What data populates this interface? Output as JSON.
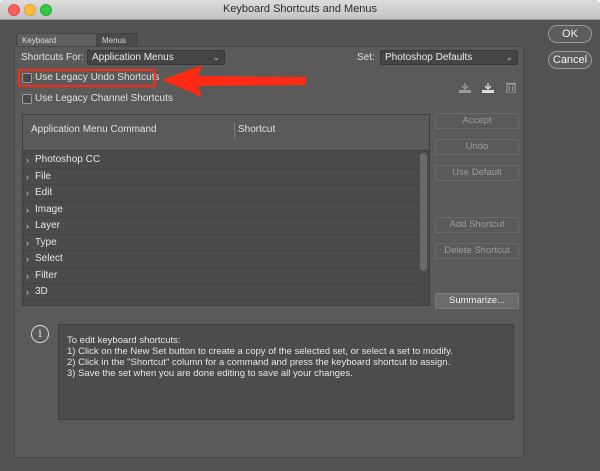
{
  "window": {
    "title": "Keyboard Shortcuts and Menus"
  },
  "tabs": [
    {
      "label": "Keyboard Shortcuts"
    },
    {
      "label": "Menus"
    }
  ],
  "shortcuts_for": {
    "label": "Shortcuts For:",
    "value": "Application Menus"
  },
  "set": {
    "label": "Set:",
    "value": "Photoshop Defaults"
  },
  "options": {
    "legacy_undo": "Use Legacy Undo Shortcuts",
    "legacy_channel": "Use Legacy Channel Shortcuts"
  },
  "table": {
    "col_command": "Application Menu Command",
    "col_shortcut": "Shortcut",
    "rows": [
      "Photoshop CC",
      "File",
      "Edit",
      "Image",
      "Layer",
      "Type",
      "Select",
      "Filter",
      "3D"
    ]
  },
  "side_buttons": {
    "accept": "Accept",
    "undo": "Undo",
    "use_default": "Use Default",
    "add_shortcut": "Add Shortcut",
    "delete_shortcut": "Delete Shortcut",
    "summarize": "Summarize..."
  },
  "dialog_buttons": {
    "ok": "OK",
    "cancel": "Cancel"
  },
  "info": {
    "lines": [
      "To edit keyboard shortcuts:",
      "1) Click on the New Set button to create a copy of the selected set, or select a set to modify.",
      "2) Click in the \"Shortcut\" column for a command and press the keyboard shortcut to assign.",
      "3) Save the set when you are done editing to save all your changes."
    ]
  },
  "icons": {
    "save_set": "save-set-icon",
    "new_set": "new-set-icon",
    "delete_set": "trash-icon",
    "info": "info-icon",
    "annotation": "red-arrow-annotation"
  },
  "colors": {
    "annotation": "#ff2a14",
    "dialog_bg": "#535353"
  }
}
